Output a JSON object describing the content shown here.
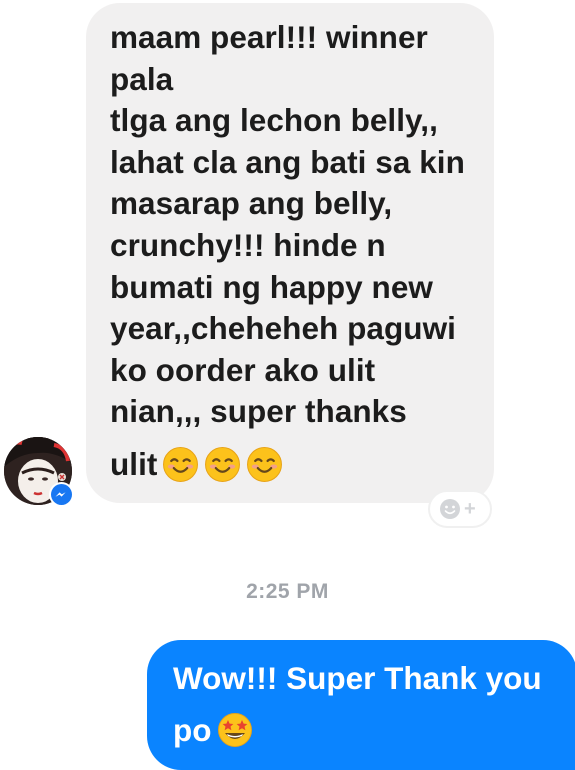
{
  "conversation": {
    "incoming_message": {
      "lines": [
        "maam pearl!!! winner",
        "pala",
        "tlga ang lechon belly,,",
        "lahat cla ang bati sa kin",
        "masarap ang belly,",
        "crunchy!!! hinde n",
        "bumati ng happy new",
        "year,,cheheheh paguwi",
        "ko oorder ako ulit",
        "nian,,, super thanks"
      ],
      "last_line_text": "ulit",
      "last_line_emojis": [
        "smiling-face-icon",
        "smiling-face-icon",
        "smiling-face-icon"
      ]
    },
    "sender": {
      "avatar_icon": "avatar",
      "badge_icon": "messenger-icon"
    },
    "reaction_button": {
      "icon": "add-reaction-icon",
      "label": "+"
    },
    "timestamp": "2:25 PM",
    "outgoing_message": {
      "line1": "Wow!!! Super Thank you",
      "line2": "po",
      "emoji": "star-struck-icon"
    }
  },
  "colors": {
    "incoming_bubble": "#f1f0f0",
    "outgoing_bubble": "#0a84ff",
    "timestamp": "#a0a4aa",
    "messenger_badge": "#1877f2"
  }
}
